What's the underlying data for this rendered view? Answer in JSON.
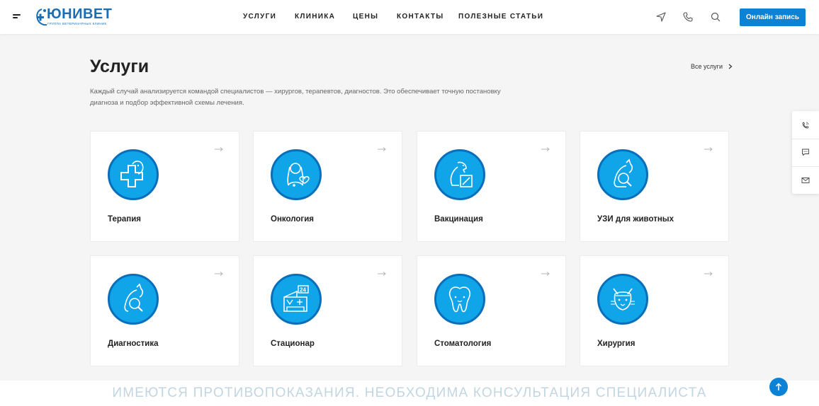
{
  "header": {
    "logo_text": "ЮНИВЕТ",
    "logo_subtitle": "ГРУППА ВЕТЕРИНАРНЫХ КЛИНИК",
    "nav": [
      "УСЛУГИ",
      "КЛИНИКА",
      "ЦЕНЫ",
      "КОНТАКТЫ",
      "ПОЛЕЗНЫЕ СТАТЬИ"
    ],
    "icons": [
      "location-icon",
      "phone-icon",
      "search-icon"
    ],
    "cta_label": "Онлайн запись"
  },
  "main": {
    "title": "Услуги",
    "all_link": "Все услуги",
    "description": "Каждый случай анализируется командой специалистов — хирургов, терапевтов, диагностов. Это обеспечивает точную постановку диагноза и подбор эффективной схемы лечения.",
    "services": [
      {
        "label": "Терапия",
        "icon": "therapy-icon"
      },
      {
        "label": "Онкология",
        "icon": "oncology-icon"
      },
      {
        "label": "Вакцинация",
        "icon": "vaccination-icon"
      },
      {
        "label": "УЗИ для животных",
        "icon": "ultrasound-icon"
      },
      {
        "label": "Диагностика",
        "icon": "diagnostics-icon"
      },
      {
        "label": "Стационар",
        "icon": "hospital-icon"
      },
      {
        "label": "Стоматология",
        "icon": "tooth-icon"
      },
      {
        "label": "Хирургия",
        "icon": "surgery-icon"
      }
    ]
  },
  "side_widget": [
    "phone-call-icon",
    "chat-icon",
    "mail-icon"
  ],
  "footer": {
    "warning": "ИМЕЮТСЯ ПРОТИВОПОКАЗАНИЯ. НЕОБХОДИМА КОНСУЛЬТАЦИЯ СПЕЦИАЛИСТА"
  },
  "colors": {
    "accent": "#0b82d6",
    "icon_fill": "#10a4e8",
    "icon_ring": "#0a6fba",
    "background": "#f5f5f5"
  }
}
